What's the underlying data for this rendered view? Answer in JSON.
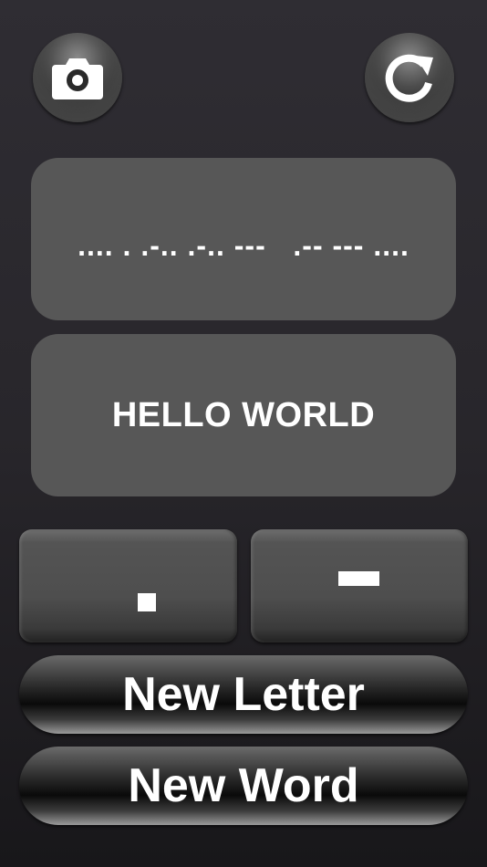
{
  "toolbar": {
    "camera_icon": "camera-icon",
    "refresh_icon": "refresh-icon"
  },
  "morse_output": ".... . .-.. .-.. ---   .-- --- ....",
  "text_output": "HELLO WORLD",
  "keys": {
    "dot_symbol": "dot",
    "dash_symbol": "dash"
  },
  "actions": {
    "new_letter_label": "New Letter",
    "new_word_label": "New Word"
  },
  "colors": {
    "panel": "#575757",
    "text": "#ffffff",
    "background": "#2b292e"
  }
}
